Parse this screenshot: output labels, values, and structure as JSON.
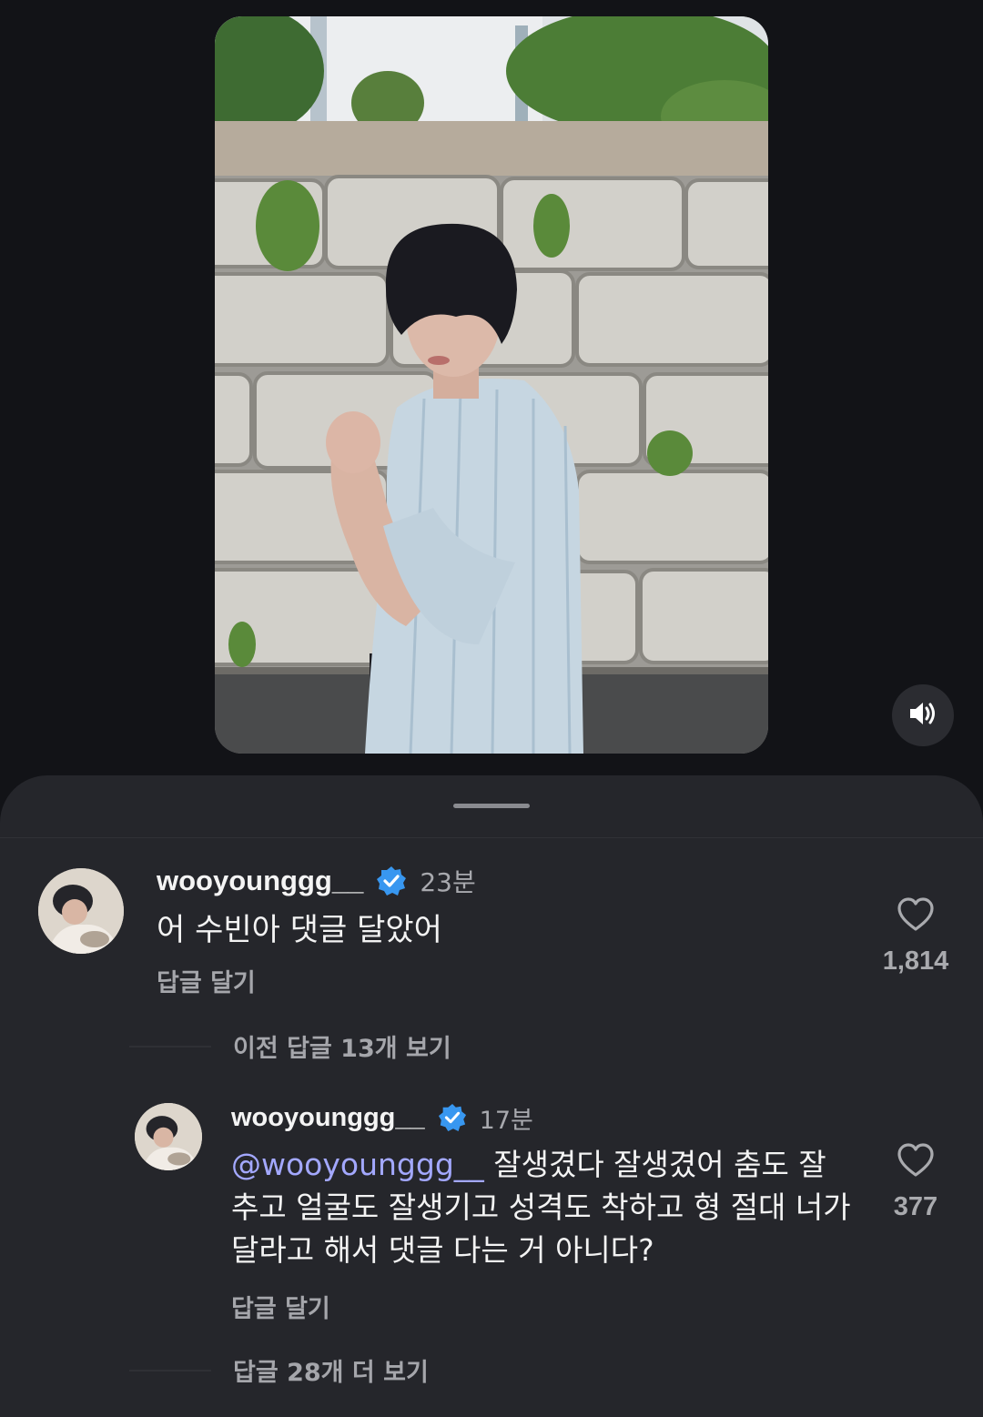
{
  "video": {
    "mute_icon": "speaker-icon",
    "scene": "man-in-striped-shirt-before-stone-wall"
  },
  "comments": [
    {
      "username": "wooyounggg__",
      "verified": true,
      "time": "23분",
      "text": "어 수빈아 댓글 달았어",
      "reply_label": "답글 달기",
      "likes": "1,814"
    },
    {
      "username": "wooyounggg__",
      "verified": true,
      "time": "17분",
      "mention": "@wooyounggg__",
      "text": " 잘생겼다 잘생겼어 춤도 잘 추고 얼굴도 잘생기고 성격도 착하고 형 절대 너가 달라고 해서 댓글 다는 거 아니다?",
      "reply_label": "답글 달기",
      "likes": "377"
    }
  ],
  "view_previous_replies": "이전 답글 13개 보기",
  "view_more_replies": "답글 28개 더 보기",
  "colors": {
    "background": "#121317",
    "sheet": "#25262b",
    "mention": "#a3a8ff",
    "verified": "#3897f0"
  }
}
